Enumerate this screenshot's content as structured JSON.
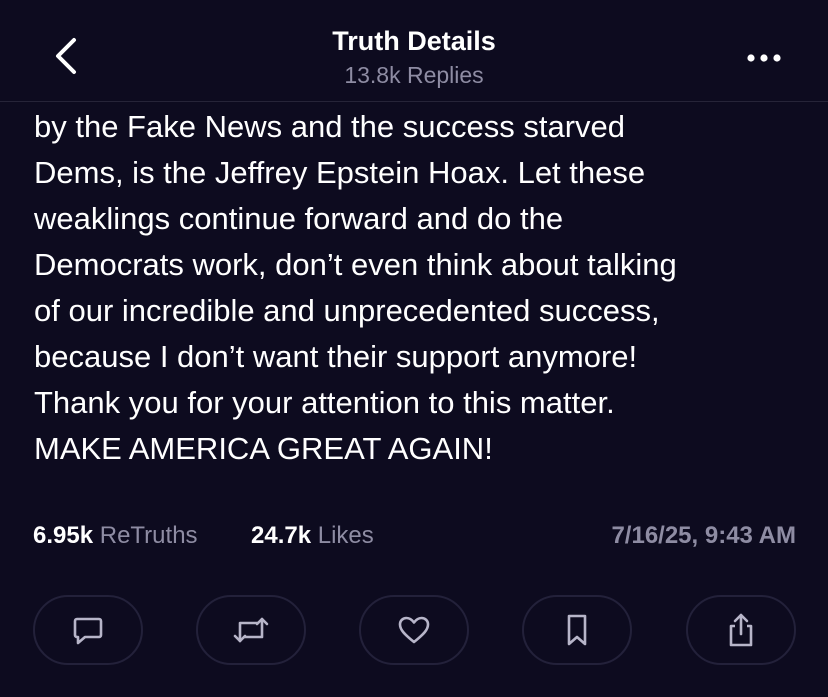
{
  "header": {
    "title": "Truth Details",
    "subtitle": "13.8k Replies",
    "back_icon": "chevron-left-icon",
    "more_icon": "more-horizontal-icon"
  },
  "post": {
    "lines": [
      "by the Fake News and the success starved",
      "Dems, is the Jeffrey Epstein Hoax. Let these",
      "weaklings continue forward and do the",
      "Democrats work, don’t even think about talking",
      "of our incredible and unprecedented success,",
      "because I don’t want their support anymore!",
      "Thank you for your attention to this matter.",
      "MAKE AMERICA GREAT AGAIN!"
    ]
  },
  "stats": {
    "retruths_count": "6.95k",
    "retruths_label": "ReTruths",
    "likes_count": "24.7k",
    "likes_label": "Likes",
    "timestamp": "7/16/25, 9:43 AM"
  },
  "actions": [
    {
      "icon": "reply-icon"
    },
    {
      "icon": "retruth-icon"
    },
    {
      "icon": "heart-icon"
    },
    {
      "icon": "bookmark-icon"
    },
    {
      "icon": "share-icon"
    }
  ],
  "colors": {
    "background": "#0d0b1f",
    "text": "#ffffff",
    "muted": "#8e8ca3",
    "border": "#23213a"
  }
}
